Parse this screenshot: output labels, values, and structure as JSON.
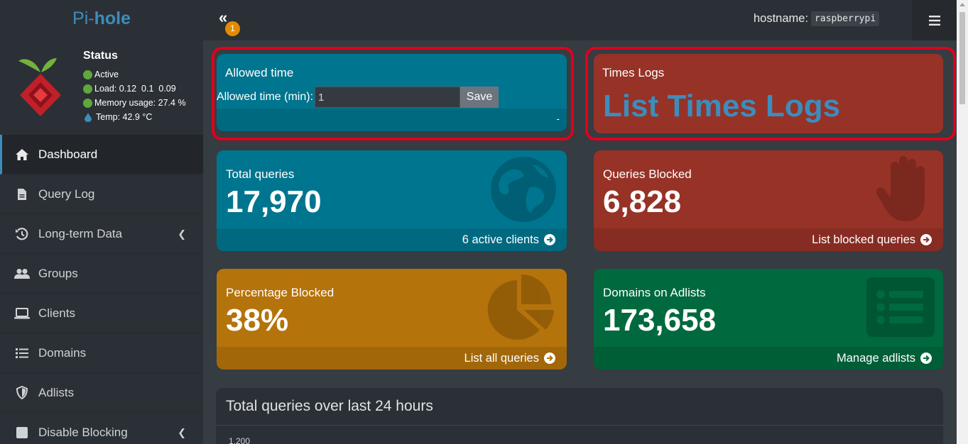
{
  "brand": {
    "prefix": "Pi-",
    "name": "hole"
  },
  "status": {
    "title": "Status",
    "active": "Active",
    "load_label": "Load:",
    "load_values": "0.12  0.1  0.09",
    "memory_label": "Memory usage:",
    "memory_value": "27.4 %",
    "temp": "Temp: 42.9 °C"
  },
  "menu": [
    {
      "label": "Dashboard",
      "icon": "home-icon"
    },
    {
      "label": "Query Log",
      "icon": "file-icon"
    },
    {
      "label": "Long-term Data",
      "icon": "history-icon"
    },
    {
      "label": "Groups",
      "icon": "users-icon"
    },
    {
      "label": "Clients",
      "icon": "laptop-icon"
    },
    {
      "label": "Domains",
      "icon": "list-icon"
    },
    {
      "label": "Adlists",
      "icon": "shield-icon"
    },
    {
      "label": "Disable Blocking",
      "icon": "stop-icon"
    }
  ],
  "topbar": {
    "collapse_icon": "«",
    "badge": "1",
    "hostname_label": "hostname:",
    "hostname_value": "raspberrypi"
  },
  "allowed_time": {
    "title": "Allowed time",
    "label": "Allowed time (min):",
    "value": "1",
    "save": "Save",
    "footer": "-"
  },
  "times_logs": {
    "title": "Times Logs",
    "link": "List Times Logs"
  },
  "stats": {
    "total": {
      "title": "Total queries",
      "value": "17,970",
      "footer": "6 active clients"
    },
    "blocked": {
      "title": "Queries Blocked",
      "value": "6,828",
      "footer": "List blocked queries"
    },
    "percent": {
      "title": "Percentage Blocked",
      "value": "38%",
      "footer": "List all queries"
    },
    "domains": {
      "title": "Domains on Adlists",
      "value": "173,658",
      "footer": "Manage adlists"
    }
  },
  "chart": {
    "title": "Total queries over last 24 hours",
    "first_tick": "1,200"
  },
  "colors": {
    "aqua": "#00758f",
    "red": "#973227",
    "yellow": "#b5730b",
    "green": "#00693e",
    "highlight": "#e0001c",
    "link": "#3c8dbc"
  }
}
